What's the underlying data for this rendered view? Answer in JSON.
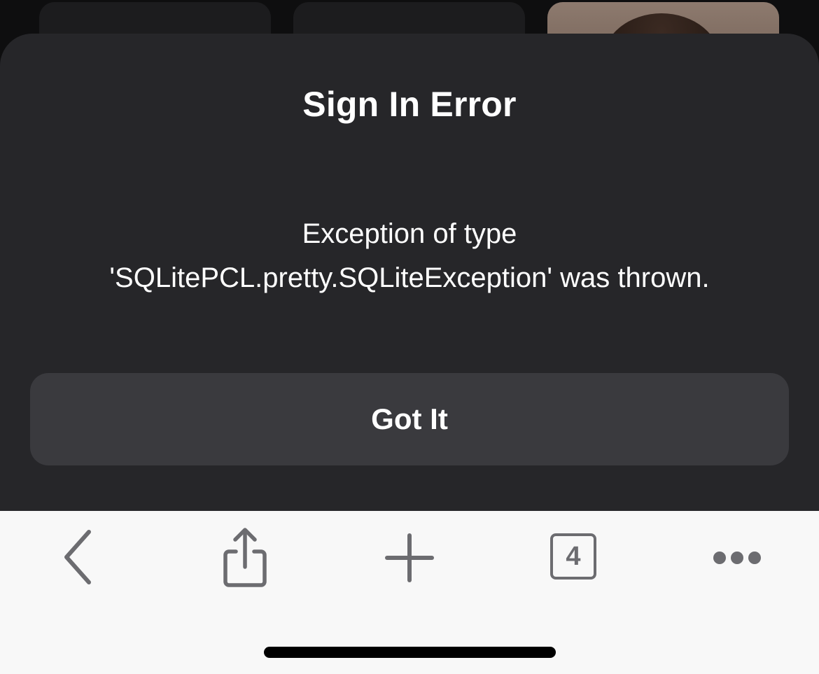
{
  "alert": {
    "title": "Sign In Error",
    "message_line1": "Exception of type",
    "message_line2": "'SQLitePCL.pretty.SQLiteException' was thrown.",
    "button_label": "Got It"
  },
  "toolbar": {
    "back_icon": "chevron-left-icon",
    "share_icon": "share-icon",
    "new_tab_icon": "plus-icon",
    "tab_count": "4",
    "more_icon": "ellipsis-icon",
    "icon_color": "#6c6c70"
  },
  "colors": {
    "sheet_background": "#262629",
    "button_background": "#3a3a3e",
    "toolbar_background": "#f8f8f8"
  }
}
